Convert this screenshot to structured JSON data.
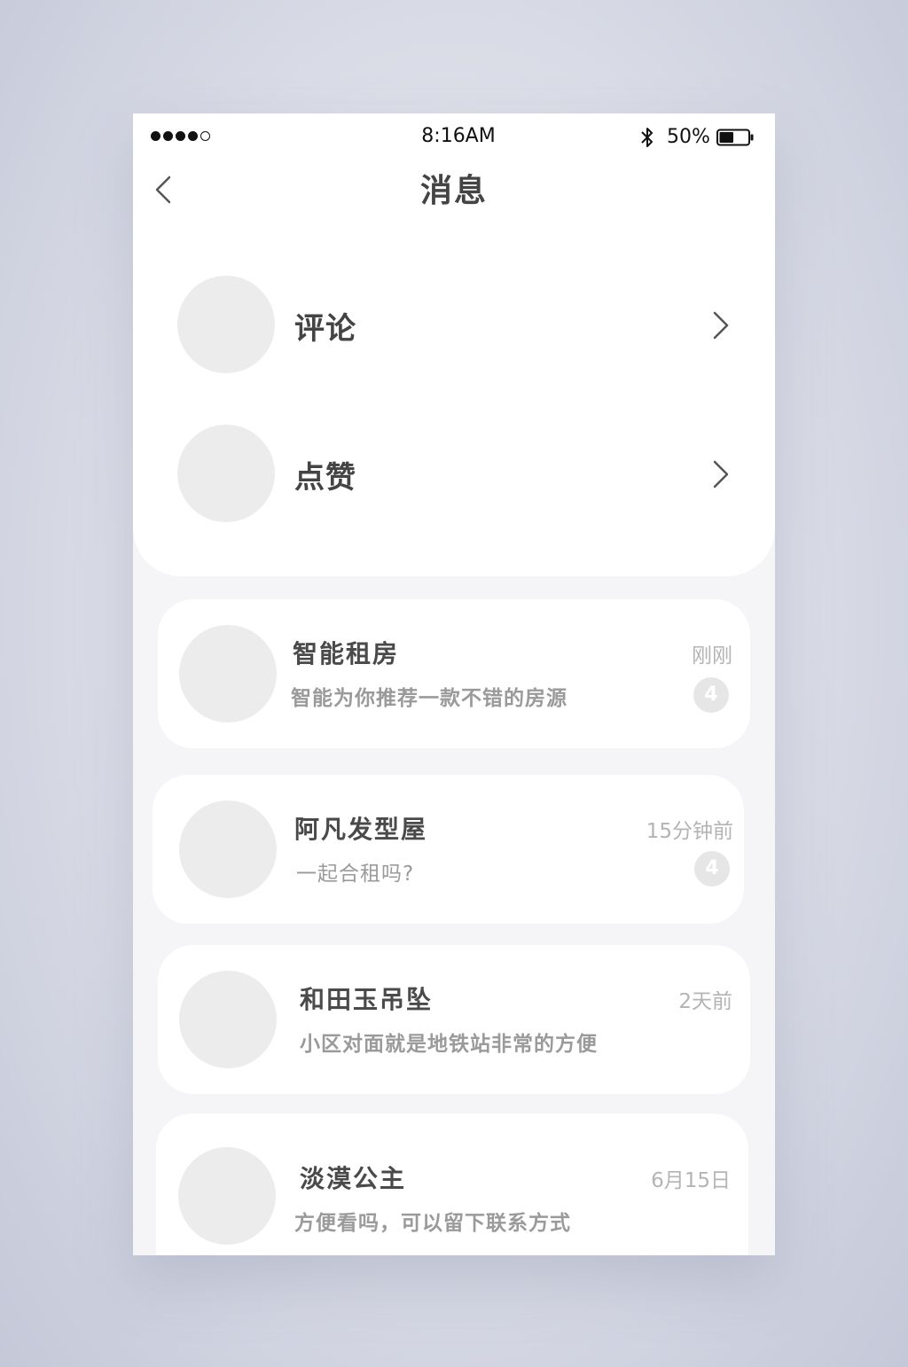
{
  "status_bar": {
    "time": "8:16AM",
    "battery_percent": "50%",
    "battery_level": 0.5,
    "signal_bars_filled": 4,
    "signal_bars_total": 5,
    "bluetooth_icon": "bluetooth-icon"
  },
  "header": {
    "title": "消息",
    "back_icon": "chevron-left-icon"
  },
  "entries": [
    {
      "label": "评论",
      "icon": "chevron-right-icon"
    },
    {
      "label": "点赞",
      "icon": "chevron-right-icon"
    }
  ],
  "messages": [
    {
      "name": "智能租房",
      "preview": "智能为你推荐一款不错的房源",
      "time": "刚刚",
      "badge": "4"
    },
    {
      "name": "阿凡发型屋",
      "preview": "一起合租吗?",
      "time": "15分钟前",
      "badge": "4"
    },
    {
      "name": "和田玉吊坠",
      "preview": "小区对面就是地铁站非常的方便",
      "time": "2天前"
    },
    {
      "name": "淡漠公主",
      "preview": "方便看吗，可以留下联系方式",
      "time": "6月15日"
    }
  ],
  "colors": {
    "background": "#d9dce6",
    "panel": "#ffffff",
    "list_bg": "#f5f5f7",
    "avatar_placeholder": "#ececec",
    "primary_text": "#444444",
    "secondary_text": "#9a9a9a",
    "badge": "#e6e6e6"
  }
}
